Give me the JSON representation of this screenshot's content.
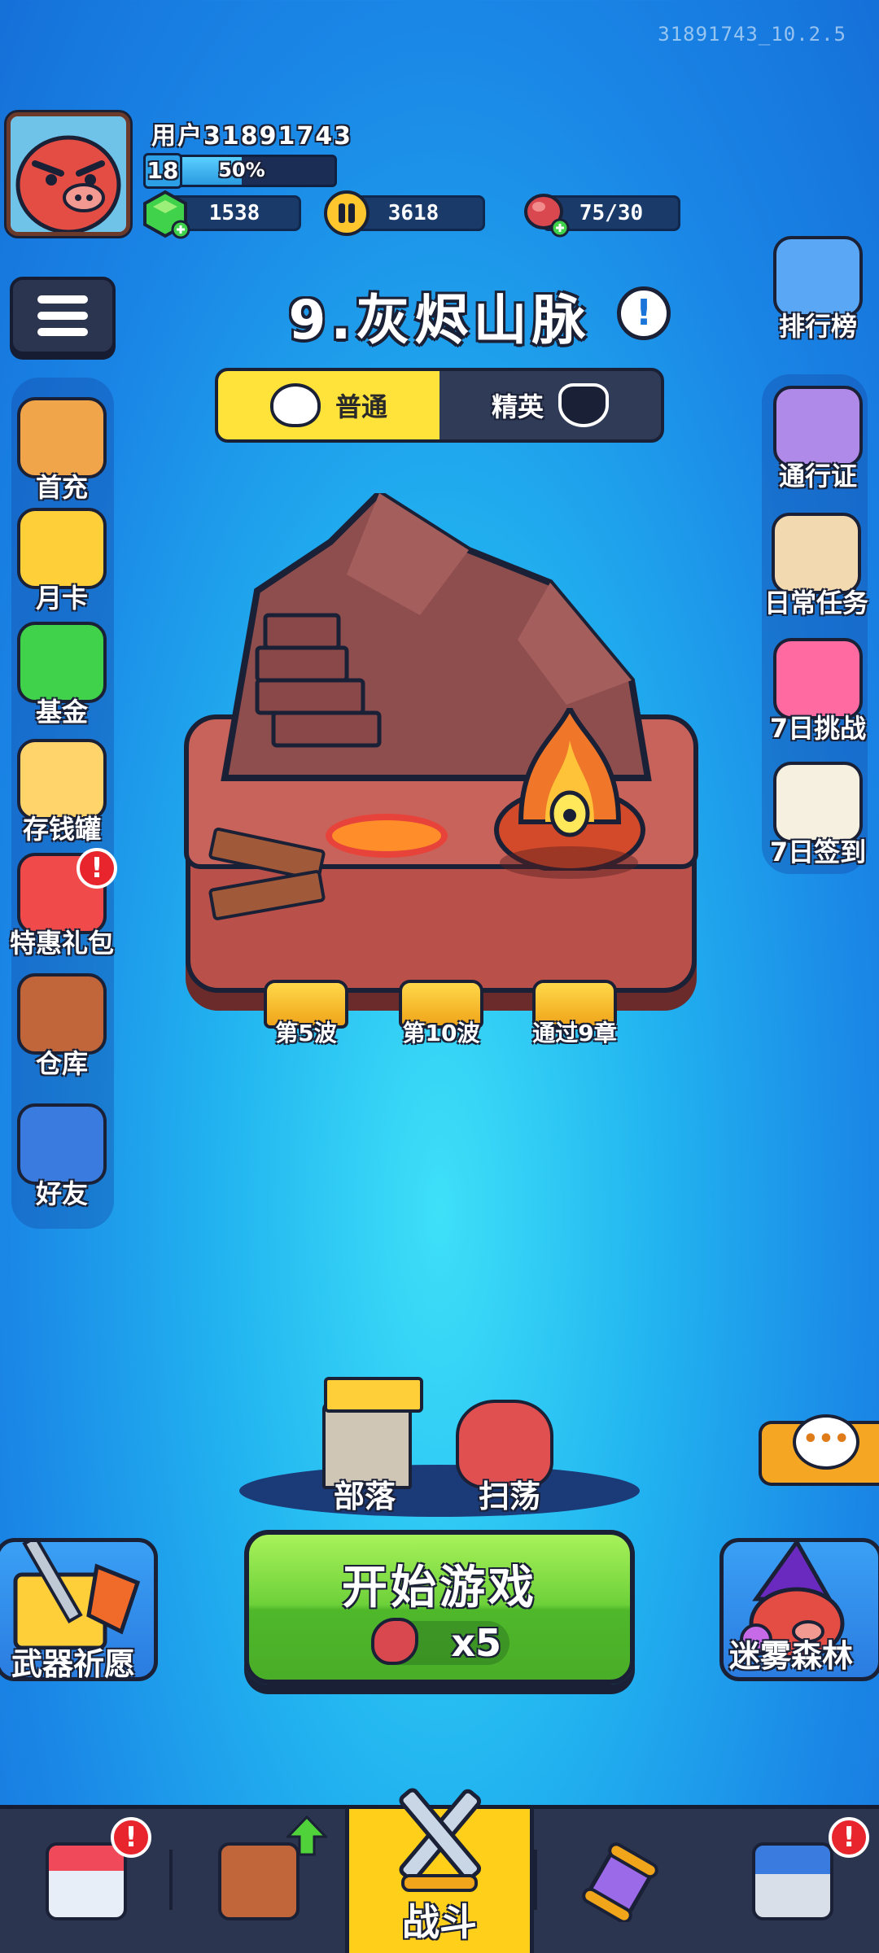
{
  "version": "31891743_10.2.5",
  "profile": {
    "username": "用户31891743",
    "level": "18",
    "xp_percent_label": "50%",
    "xp_fraction": 0.5
  },
  "resources": {
    "gems": "1538",
    "coins": "3618",
    "stamina": "75/30"
  },
  "stage": {
    "title": "9.灰烬山脉",
    "modes": {
      "normal": "普通",
      "elite": "精英",
      "active": "normal"
    },
    "milestones": [
      "第5波",
      "第10波",
      "通过9章"
    ]
  },
  "left_menu": [
    {
      "label": "首充",
      "icon": "first-recharge-icon"
    },
    {
      "label": "月卡",
      "icon": "monthly-card-icon"
    },
    {
      "label": "基金",
      "icon": "fund-icon"
    },
    {
      "label": "存钱罐",
      "icon": "piggy-bank-icon"
    },
    {
      "label": "特惠礼包",
      "icon": "gift-pack-icon",
      "badge": "!"
    },
    {
      "label": "仓库",
      "icon": "backpack-icon"
    },
    {
      "label": "好友",
      "icon": "friends-icon"
    }
  ],
  "right_menu": [
    {
      "label": "排行榜",
      "icon": "leaderboard-icon"
    },
    {
      "label": "通行证",
      "icon": "pass-icon"
    },
    {
      "label": "日常任务",
      "icon": "daily-task-icon"
    },
    {
      "label": "7日挑战",
      "icon": "seven-day-challenge-icon"
    },
    {
      "label": "7日签到",
      "icon": "seven-day-checkin-icon"
    }
  ],
  "actions": {
    "tribe": "部落",
    "sweep": "扫荡",
    "start": "开始游戏",
    "start_cost": "x5",
    "weapon_wish": "武器祈愿",
    "misty_forest": "迷雾森林"
  },
  "nav": {
    "shop_badge": "!",
    "last_badge": "!",
    "battle": "战斗"
  },
  "colors": {
    "accent_yellow": "#ffcf1a",
    "start_green": "#6ed13a",
    "badge_red": "#e8242c",
    "panel_dark": "#2b3550"
  }
}
